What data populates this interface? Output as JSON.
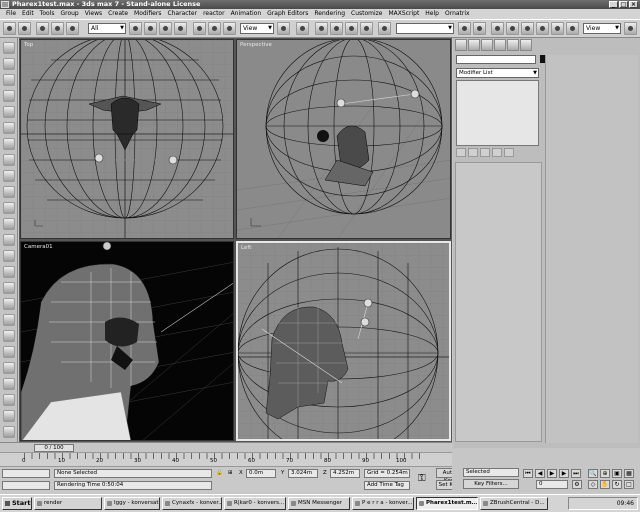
{
  "window": {
    "title": "Pharex1test.max - 3ds max 7 - Stand-alone License"
  },
  "menu": [
    "File",
    "Edit",
    "Tools",
    "Group",
    "Views",
    "Create",
    "Modifiers",
    "Character",
    "reactor",
    "Animation",
    "Graph Editors",
    "Rendering",
    "Customize",
    "MAXScript",
    "Help",
    "Ornatrix"
  ],
  "toolbar": {
    "selection_filter": "All",
    "coord_system": "View",
    "named_selection": "",
    "view_right": "View"
  },
  "viewports": [
    {
      "label": "Top"
    },
    {
      "label": "Perspective"
    },
    {
      "label": "Camera01"
    },
    {
      "label": "Left"
    }
  ],
  "command_panel": {
    "modifier_list": "Modifier List"
  },
  "time": {
    "slider": "0 / 100",
    "ticks": [
      "0",
      "10",
      "20",
      "30",
      "40",
      "50",
      "60",
      "70",
      "80",
      "90",
      "100"
    ]
  },
  "status": {
    "selection": "None Selected",
    "render_time": "Rendering Time  0:50:04",
    "x_label": "X",
    "x_value": "0.0m",
    "y_label": "Y",
    "y_value": "3.024m",
    "z_label": "Z",
    "z_value": "4.252m",
    "grid": "Grid = 0.254m",
    "add_time_tag": "Add Time Tag",
    "auto_key": "Auto Key",
    "set_key": "Set Key",
    "selected": "Selected",
    "key_filters": "Key Filters...",
    "frame": "0"
  },
  "taskbar": {
    "start": "Start",
    "items": [
      "render",
      "Iggy - konversation",
      "Cynaxfx - konver...",
      "R|kar0 - konvers...",
      "MSN Messenger",
      "P e r r a - konver...",
      "Pharex1test.m...",
      "ZBrushCentral - D..."
    ],
    "clock": "09:46"
  }
}
